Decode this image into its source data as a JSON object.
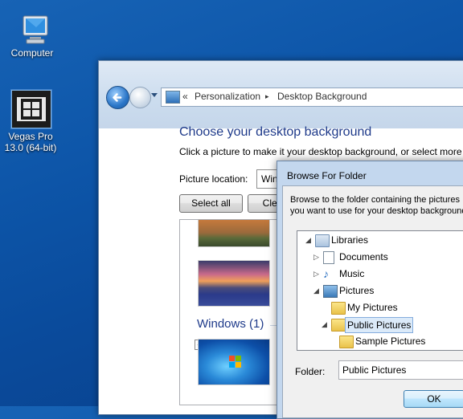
{
  "desktop": {
    "computer_label": "Computer",
    "vegas_label_line1": "Vegas Pro",
    "vegas_label_line2": "13.0 (64-bit)"
  },
  "window": {
    "breadcrumb_sep0": "«",
    "breadcrumb_item1": "Personalization",
    "breadcrumb_sep1": "▸",
    "breadcrumb_item2": "Desktop Background",
    "heading": "Choose your desktop background",
    "subtext": "Click a picture to make it your desktop background, or select more",
    "location_label": "Picture location:",
    "location_value": "Wind",
    "select_all": "Select all",
    "clear_all": "Clea",
    "group_header": "Windows (1)"
  },
  "dialog": {
    "title": "Browse For Folder",
    "description": "Browse to the folder containing the pictures you want to use for your desktop background.",
    "tree": {
      "libraries": "Libraries",
      "documents": "Documents",
      "music": "Music",
      "pictures": "Pictures",
      "my_pictures": "My Pictures",
      "public_pictures": "Public Pictures",
      "sample_pictures": "Sample Pictures"
    },
    "folder_label": "Folder:",
    "folder_value": "Public Pictures",
    "ok": "OK"
  }
}
